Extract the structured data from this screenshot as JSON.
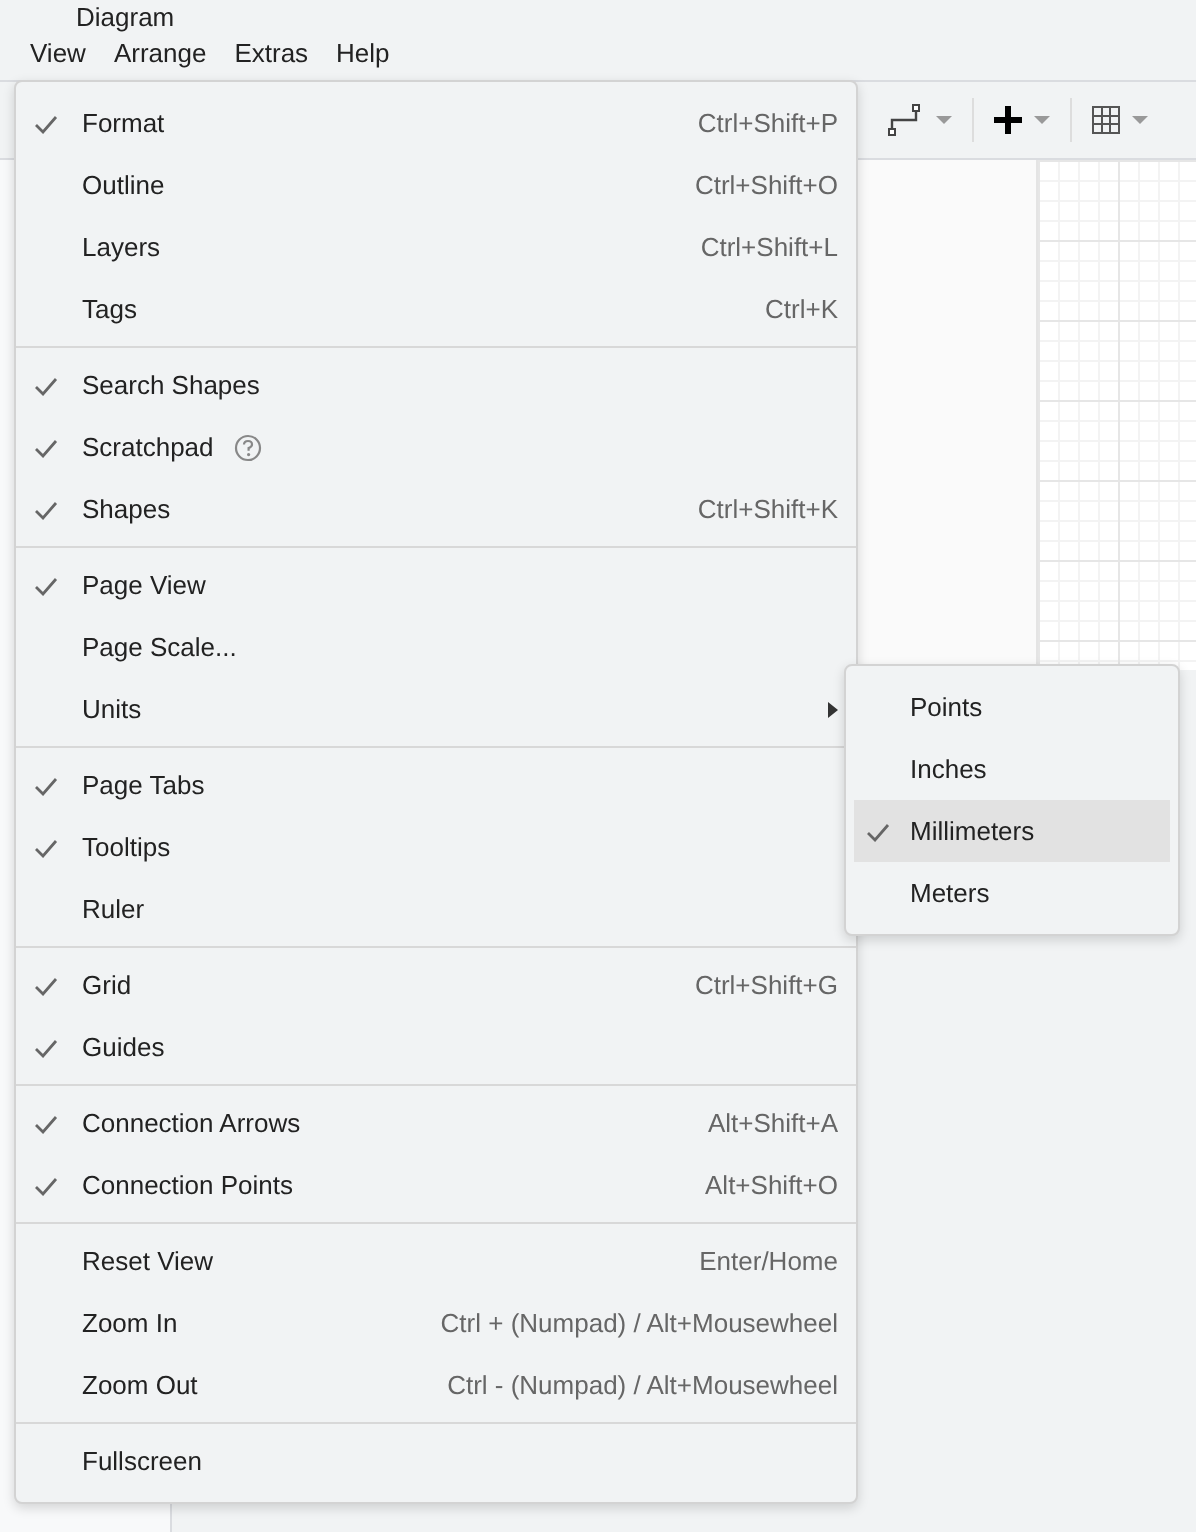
{
  "window": {
    "title": "Diagram"
  },
  "menubar": [
    {
      "label": "View"
    },
    {
      "label": "Arrange"
    },
    {
      "label": "Extras"
    },
    {
      "label": "Help"
    }
  ],
  "menu": {
    "sections": [
      [
        {
          "label": "Format",
          "shortcut": "Ctrl+Shift+P",
          "checked": true,
          "kind": "item"
        },
        {
          "label": "Outline",
          "shortcut": "Ctrl+Shift+O",
          "checked": false,
          "kind": "item"
        },
        {
          "label": "Layers",
          "shortcut": "Ctrl+Shift+L",
          "checked": false,
          "kind": "item"
        },
        {
          "label": "Tags",
          "shortcut": "Ctrl+K",
          "checked": false,
          "kind": "item"
        }
      ],
      [
        {
          "label": "Search Shapes",
          "checked": true,
          "kind": "item"
        },
        {
          "label": "Scratchpad",
          "checked": true,
          "kind": "help"
        },
        {
          "label": "Shapes",
          "shortcut": "Ctrl+Shift+K",
          "checked": true,
          "kind": "item"
        }
      ],
      [
        {
          "label": "Page View",
          "checked": true,
          "kind": "item"
        },
        {
          "label": "Page Scale...",
          "checked": false,
          "kind": "item"
        },
        {
          "label": "Units",
          "checked": false,
          "kind": "submenu"
        }
      ],
      [
        {
          "label": "Page Tabs",
          "checked": true,
          "kind": "item"
        },
        {
          "label": "Tooltips",
          "checked": true,
          "kind": "item"
        },
        {
          "label": "Ruler",
          "checked": false,
          "kind": "item"
        }
      ],
      [
        {
          "label": "Grid",
          "shortcut": "Ctrl+Shift+G",
          "checked": true,
          "kind": "item"
        },
        {
          "label": "Guides",
          "checked": true,
          "kind": "item"
        }
      ],
      [
        {
          "label": "Connection Arrows",
          "shortcut": "Alt+Shift+A",
          "checked": true,
          "kind": "item"
        },
        {
          "label": "Connection Points",
          "shortcut": "Alt+Shift+O",
          "checked": true,
          "kind": "item"
        }
      ],
      [
        {
          "label": "Reset View",
          "shortcut": "Enter/Home",
          "checked": false,
          "kind": "item"
        },
        {
          "label": "Zoom In",
          "shortcut": "Ctrl + (Numpad) / Alt+Mousewheel",
          "checked": false,
          "kind": "item"
        },
        {
          "label": "Zoom Out",
          "shortcut": "Ctrl - (Numpad) / Alt+Mousewheel",
          "checked": false,
          "kind": "item"
        }
      ],
      [
        {
          "label": "Fullscreen",
          "checked": false,
          "kind": "item"
        }
      ]
    ]
  },
  "submenu": {
    "items": [
      {
        "label": "Points",
        "checked": false,
        "selected": false
      },
      {
        "label": "Inches",
        "checked": false,
        "selected": false
      },
      {
        "label": "Millimeters",
        "checked": true,
        "selected": true
      },
      {
        "label": "Meters",
        "checked": false,
        "selected": false
      }
    ]
  },
  "toolbar": [
    {
      "kind": "waypoint"
    },
    {
      "kind": "insert"
    },
    {
      "kind": "table"
    }
  ]
}
